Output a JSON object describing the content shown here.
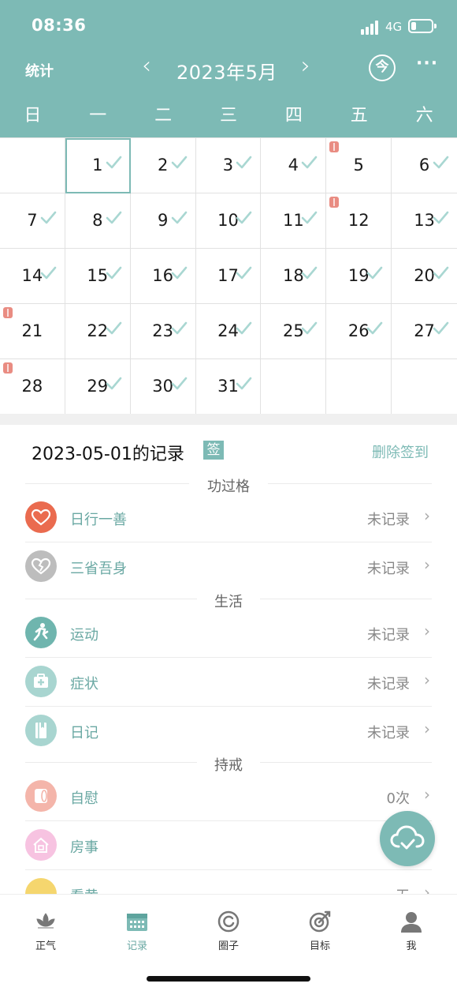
{
  "status_bar": {
    "time": "08:36",
    "network": "4G"
  },
  "header": {
    "stats_label": "统计",
    "prev_symbol": "‹",
    "next_symbol": "›",
    "month_title": "2023年5月",
    "today_label": "今",
    "more_symbol": "···"
  },
  "weekdays": [
    "日",
    "一",
    "二",
    "三",
    "四",
    "五",
    "六"
  ],
  "calendar": {
    "days": [
      {
        "d": "",
        "check": false,
        "mark": false
      },
      {
        "d": "1",
        "check": true,
        "mark": false,
        "selected": true
      },
      {
        "d": "2",
        "check": true,
        "mark": false
      },
      {
        "d": "3",
        "check": true,
        "mark": false
      },
      {
        "d": "4",
        "check": true,
        "mark": false
      },
      {
        "d": "5",
        "check": false,
        "mark": true
      },
      {
        "d": "6",
        "check": true,
        "mark": false
      },
      {
        "d": "7",
        "check": true,
        "mark": false
      },
      {
        "d": "8",
        "check": true,
        "mark": false
      },
      {
        "d": "9",
        "check": true,
        "mark": false
      },
      {
        "d": "10",
        "check": true,
        "mark": false
      },
      {
        "d": "11",
        "check": true,
        "mark": false
      },
      {
        "d": "12",
        "check": false,
        "mark": true
      },
      {
        "d": "13",
        "check": true,
        "mark": false
      },
      {
        "d": "14",
        "check": true,
        "mark": false
      },
      {
        "d": "15",
        "check": true,
        "mark": false
      },
      {
        "d": "16",
        "check": true,
        "mark": false
      },
      {
        "d": "17",
        "check": true,
        "mark": false
      },
      {
        "d": "18",
        "check": true,
        "mark": false
      },
      {
        "d": "19",
        "check": true,
        "mark": false
      },
      {
        "d": "20",
        "check": true,
        "mark": false
      },
      {
        "d": "21",
        "check": false,
        "mark": true
      },
      {
        "d": "22",
        "check": true,
        "mark": false
      },
      {
        "d": "23",
        "check": true,
        "mark": false
      },
      {
        "d": "24",
        "check": true,
        "mark": false
      },
      {
        "d": "25",
        "check": true,
        "mark": false
      },
      {
        "d": "26",
        "check": true,
        "mark": false
      },
      {
        "d": "27",
        "check": true,
        "mark": false
      },
      {
        "d": "28",
        "check": false,
        "mark": true
      },
      {
        "d": "29",
        "check": true,
        "mark": false
      },
      {
        "d": "30",
        "check": true,
        "mark": false
      },
      {
        "d": "31",
        "check": true,
        "mark": false
      },
      {
        "d": "",
        "check": false,
        "mark": false
      },
      {
        "d": "",
        "check": false,
        "mark": false
      },
      {
        "d": "",
        "check": false,
        "mark": false
      }
    ]
  },
  "record": {
    "title": "2023-05-01的记录",
    "sign_badge": "签",
    "delete_label": "删除签到"
  },
  "sections": {
    "merit": "功过格",
    "life": "生活",
    "precepts": "持戒"
  },
  "rows": {
    "good_deed": {
      "label": "日行一善",
      "value": "未记录"
    },
    "reflection": {
      "label": "三省吾身",
      "value": "未记录"
    },
    "exercise": {
      "label": "运动",
      "value": "未记录"
    },
    "symptom": {
      "label": "症状",
      "value": "未记录"
    },
    "diary": {
      "label": "日记",
      "value": "未记录"
    },
    "self_comfort": {
      "label": "自慰",
      "value": "0次"
    },
    "intercourse": {
      "label": "房事",
      "value": ""
    },
    "partial": {
      "label": "看黄",
      "value": "无"
    }
  },
  "chevron": "›",
  "tabs": {
    "zhengqi": "正气",
    "records": "记录",
    "circle": "圈子",
    "goals": "目标",
    "me": "我"
  },
  "colors": {
    "accent": "#7dbab5",
    "heart_icon": "#ea6b4f",
    "reflection_icon": "#bdbdbd",
    "exercise_icon": "#6fb5ae",
    "symptom_icon": "#a8d5d0",
    "diary_icon": "#a8d5d0",
    "self_comfort_icon": "#f4b5aa",
    "intercourse_icon": "#f7c3e1",
    "mark": "#e98c82"
  }
}
